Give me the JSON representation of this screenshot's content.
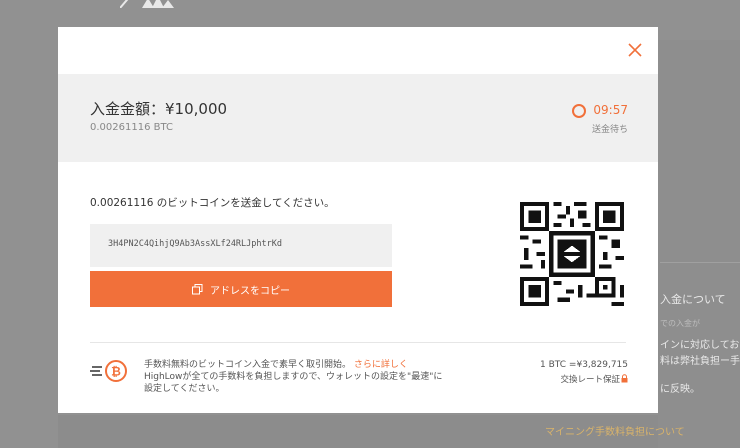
{
  "background": {
    "right_panel_lines": [
      "入金について",
      "での入金が",
      "インに対応しており",
      "料は弊社負担ー手数料は",
      "に反映。"
    ],
    "link": "マイニング手数料負担について"
  },
  "modal": {
    "amount_label": "入金金額：¥10,000",
    "amount_btc": "0.00261116 BTC",
    "timer": "09:57",
    "status": "送金待ち",
    "instruction": "0.00261116 のビットコインを送金してください。",
    "address": "3H4PN2C4QihjQ9Ab3AssXLf24RLJphtrKd",
    "copy_button_label": "アドレスをコピー",
    "note_text_1": "手数料無料のビットコイン入金で素早く取引開始。",
    "note_link": "さらに詳しく",
    "note_text_2": "HighLowが全ての手数料を負担しますので、ウォレットの設定を\"最速\"に設定してください。",
    "rate": "1 BTC =¥3,829,715",
    "rate_label": "交換レート保証"
  },
  "colors": {
    "accent": "#f1703a",
    "head_bg": "#f0f0f0"
  },
  "icons": [
    "close-icon",
    "timer-ring-icon",
    "copy-icon",
    "qr-code",
    "bitcoin-icon",
    "lock-icon"
  ]
}
